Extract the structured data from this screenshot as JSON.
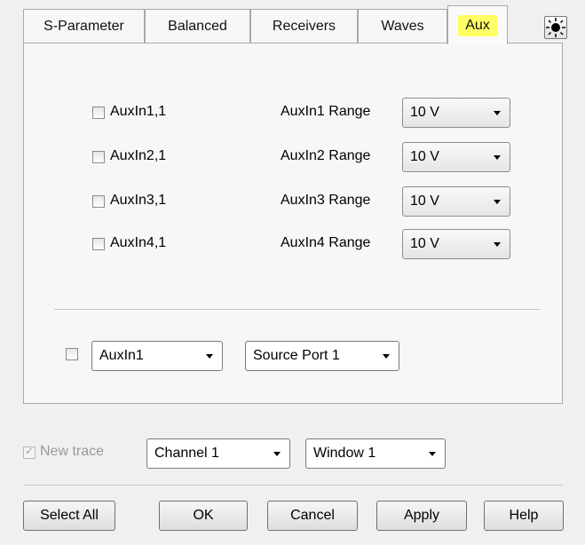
{
  "tabs": [
    {
      "label": "S-Parameter",
      "active": false
    },
    {
      "label": "Balanced",
      "active": false
    },
    {
      "label": "Receivers",
      "active": false
    },
    {
      "label": "Waves",
      "active": false
    },
    {
      "label": "Aux",
      "active": true
    }
  ],
  "highlight_color": "#ffff66",
  "settings_icon": "sun-icon",
  "aux_inputs": [
    {
      "checkbox_label": "AuxIn1,1",
      "checked": false,
      "range_label": "AuxIn1 Range",
      "range_value": "10 V"
    },
    {
      "checkbox_label": "AuxIn2,1",
      "checked": false,
      "range_label": "AuxIn2 Range",
      "range_value": "10 V"
    },
    {
      "checkbox_label": "AuxIn3,1",
      "checked": false,
      "range_label": "AuxIn3 Range",
      "range_value": "10 V"
    },
    {
      "checkbox_label": "AuxIn4,1",
      "checked": false,
      "range_label": "AuxIn4 Range",
      "range_value": "10 V"
    }
  ],
  "custom": {
    "checked": false,
    "input_value": "AuxIn1",
    "source_value": "Source Port 1"
  },
  "new_trace": {
    "label": "New trace",
    "checked": true,
    "disabled": true,
    "channel_value": "Channel 1",
    "window_value": "Window 1"
  },
  "buttons": {
    "select_all": "Select All",
    "ok": "OK",
    "cancel": "Cancel",
    "apply": "Apply",
    "help": "Help"
  }
}
